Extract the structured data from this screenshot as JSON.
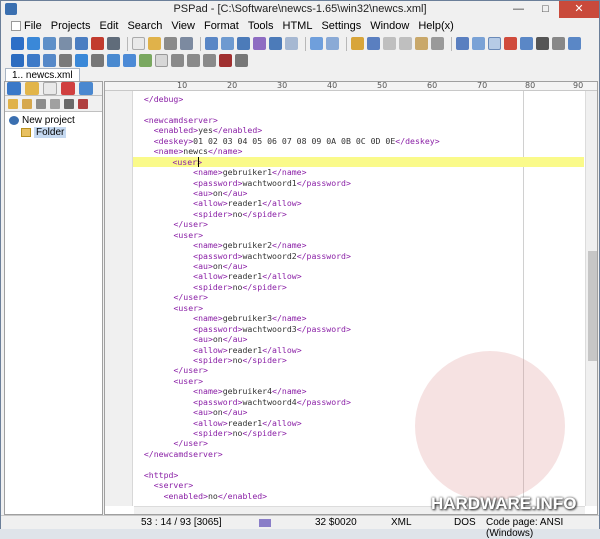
{
  "window": {
    "title": "PSPad - [C:\\Software\\newcs-1.65\\win32\\newcs.xml]",
    "min": "—",
    "max": "□",
    "close": "✕"
  },
  "menu": [
    "File",
    "Projects",
    "Edit",
    "Search",
    "View",
    "Format",
    "Tools",
    "HTML",
    "Settings",
    "Window",
    "Help(x)"
  ],
  "tab": {
    "label": "1.. newcs.xml"
  },
  "sidebar": {
    "project": "New project",
    "folder": "Folder"
  },
  "ruler": [
    "10",
    "20",
    "30",
    "40",
    "50",
    "60",
    "70",
    "80",
    "90"
  ],
  "code_lines": [
    {
      "indent": 2,
      "open": "</debug>",
      "text": "",
      "close": ""
    },
    {
      "indent": 0,
      "open": "",
      "text": "",
      "close": ""
    },
    {
      "indent": 2,
      "open": "<newcamdserver>",
      "text": "",
      "close": ""
    },
    {
      "indent": 4,
      "open": "<enabled>",
      "text": "yes",
      "close": "</enabled>"
    },
    {
      "indent": 4,
      "open": "<deskey>",
      "text": "01 02 03 04 05 06 07 08 09 0A 0B 0C 0D 0E",
      "close": "</deskey>"
    },
    {
      "indent": 4,
      "open": "<name>",
      "text": "newcs",
      "close": "</name>"
    },
    {
      "indent": 8,
      "open": "<user>",
      "text": "",
      "close": ""
    },
    {
      "indent": 12,
      "open": "<name>",
      "text": "gebruiker1",
      "close": "</name>"
    },
    {
      "indent": 12,
      "open": "<password>",
      "text": "wachtwoord1",
      "close": "</password>"
    },
    {
      "indent": 12,
      "open": "<au>",
      "text": "on",
      "close": "</au>"
    },
    {
      "indent": 12,
      "open": "<allow>",
      "text": "reader1",
      "close": "</allow>"
    },
    {
      "indent": 12,
      "open": "<spider>",
      "text": "no",
      "close": "</spider>"
    },
    {
      "indent": 8,
      "open": "</user>",
      "text": "",
      "close": ""
    },
    {
      "indent": 8,
      "open": "<user>",
      "text": "",
      "close": ""
    },
    {
      "indent": 12,
      "open": "<name>",
      "text": "gebruiker2",
      "close": "</name>"
    },
    {
      "indent": 12,
      "open": "<password>",
      "text": "wachtwoord2",
      "close": "</password>"
    },
    {
      "indent": 12,
      "open": "<au>",
      "text": "on",
      "close": "</au>"
    },
    {
      "indent": 12,
      "open": "<allow>",
      "text": "reader1",
      "close": "</allow>"
    },
    {
      "indent": 12,
      "open": "<spider>",
      "text": "no",
      "close": "</spider>"
    },
    {
      "indent": 8,
      "open": "</user>",
      "text": "",
      "close": ""
    },
    {
      "indent": 8,
      "open": "<user>",
      "text": "",
      "close": ""
    },
    {
      "indent": 12,
      "open": "<name>",
      "text": "gebruiker3",
      "close": "</name>"
    },
    {
      "indent": 12,
      "open": "<password>",
      "text": "wachtwoord3",
      "close": "</password>"
    },
    {
      "indent": 12,
      "open": "<au>",
      "text": "on",
      "close": "</au>"
    },
    {
      "indent": 12,
      "open": "<allow>",
      "text": "reader1",
      "close": "</allow>"
    },
    {
      "indent": 12,
      "open": "<spider>",
      "text": "no",
      "close": "</spider>"
    },
    {
      "indent": 8,
      "open": "</user>",
      "text": "",
      "close": ""
    },
    {
      "indent": 8,
      "open": "<user>",
      "text": "",
      "close": ""
    },
    {
      "indent": 12,
      "open": "<name>",
      "text": "gebruiker4",
      "close": "</name>"
    },
    {
      "indent": 12,
      "open": "<password>",
      "text": "wachtwoord4",
      "close": "</password>"
    },
    {
      "indent": 12,
      "open": "<au>",
      "text": "on",
      "close": "</au>"
    },
    {
      "indent": 12,
      "open": "<allow>",
      "text": "reader1",
      "close": "</allow>"
    },
    {
      "indent": 12,
      "open": "<spider>",
      "text": "no",
      "close": "</spider>"
    },
    {
      "indent": 8,
      "open": "</user>",
      "text": "",
      "close": ""
    },
    {
      "indent": 2,
      "open": "</newcamdserver>",
      "text": "",
      "close": ""
    },
    {
      "indent": 0,
      "open": "",
      "text": "",
      "close": ""
    },
    {
      "indent": 2,
      "open": "<httpd>",
      "text": "",
      "close": ""
    },
    {
      "indent": 4,
      "open": "<server>",
      "text": "",
      "close": ""
    },
    {
      "indent": 6,
      "open": "<enabled>",
      "text": "no",
      "close": "</enabled>"
    }
  ],
  "highlighted_line": 6,
  "status": {
    "position": "53 : 14 / 93  [3065]",
    "code": "32  $0020",
    "syntax": "XML",
    "format": "DOS",
    "codepage": "Code page: ANSI (Windows)"
  },
  "watermark": "HARDWARE.INFO",
  "colors": {
    "tag": "#8a1fa6",
    "highlight": "#fafa8a",
    "selection": "#c5d9f1"
  }
}
